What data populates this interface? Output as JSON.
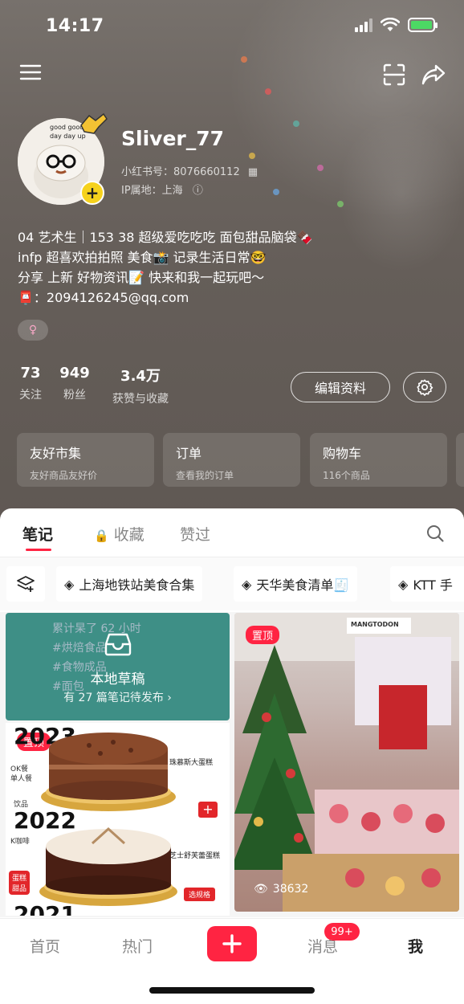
{
  "status_bar": {
    "time": "14:17"
  },
  "profile": {
    "username": "Sliver_77",
    "red_id": "小红书号：8076660112",
    "ip_location": "IP属地：上海",
    "avatar_text": "good good day day up",
    "bio_lines": [
      "04 艺术生｜153 38 超级爱吃吃吃 面包甜品脑袋🍫",
      "infp 超喜欢拍拍照 美食📸 记录生活日常🤓",
      "分享 上新 好物资讯📝 快来和我一起玩吧～",
      "📮：2094126245@qq.com"
    ],
    "gender_symbol": "♀"
  },
  "stats": [
    {
      "value": "73",
      "label": "关注"
    },
    {
      "value": "949",
      "label": "粉丝"
    },
    {
      "value": "3.4万",
      "label": "获赞与收藏"
    }
  ],
  "actions": {
    "edit_profile": "编辑资料"
  },
  "quick_cards": [
    {
      "title": "友好市集",
      "subtitle": "友好商品友好价"
    },
    {
      "title": "订单",
      "subtitle": "查看我的订单"
    },
    {
      "title": "购物车",
      "subtitle": "116个商品"
    }
  ],
  "tabs": [
    {
      "label": "笔记",
      "active": true
    },
    {
      "label": "收藏",
      "active": false
    },
    {
      "label": "赞过",
      "active": false
    }
  ],
  "collections": [
    {
      "label": "上海地铁站美食合集"
    },
    {
      "label": "天华美食清单🧾"
    },
    {
      "label": "KTT 手"
    }
  ],
  "drafts": {
    "title": "本地草稿",
    "subtitle": "有 27 篇笔记待发布 ›",
    "background_lines": [
      "累计杲了 62 小时",
      "#烘焙食品",
      "#食物成品",
      "#面包"
    ]
  },
  "cake_card": {
    "pin_label": "置顶",
    "years": [
      "2023",
      "2022",
      "2021"
    ],
    "side_labels": [
      "OK餐",
      "单人餐",
      "饮品",
      "K咖啡",
      "蛋糕 甜品"
    ],
    "item_labels": [
      "珠慕斯大蛋糕",
      "芝士舒芙蕾蛋糕"
    ],
    "option_label": "选规格"
  },
  "xmas_card": {
    "pin_label": "置顶",
    "views": "38632",
    "shop_sign": "MANGTODON"
  },
  "bottom_nav": [
    {
      "label": "首页",
      "active": false
    },
    {
      "label": "热门",
      "active": false
    },
    {
      "label": "消息",
      "active": false,
      "badge": "99+"
    },
    {
      "label": "我",
      "active": true
    }
  ],
  "colors": {
    "accent": "#ff2442",
    "badge_yellow": "#f6d21c"
  }
}
